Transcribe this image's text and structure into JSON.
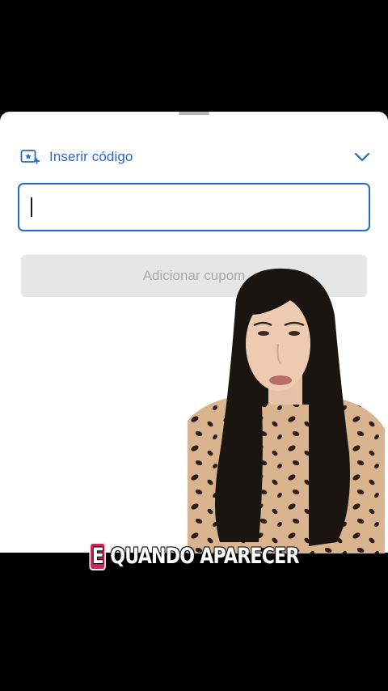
{
  "coupon": {
    "header_label": "Inserir código",
    "input_value": "",
    "add_button_label": "Adicionar cupom"
  },
  "caption": {
    "highlight_word": "E",
    "rest_text": "QUANDO APARECER"
  },
  "colors": {
    "accent": "#2968c8",
    "button_disabled_bg": "#e6e6e6",
    "button_disabled_text": "#a9a9a9",
    "caption_highlight": "#c8285e"
  },
  "icons": {
    "coupon": "ticket-star-plus-icon",
    "expand": "chevron-down-icon"
  }
}
